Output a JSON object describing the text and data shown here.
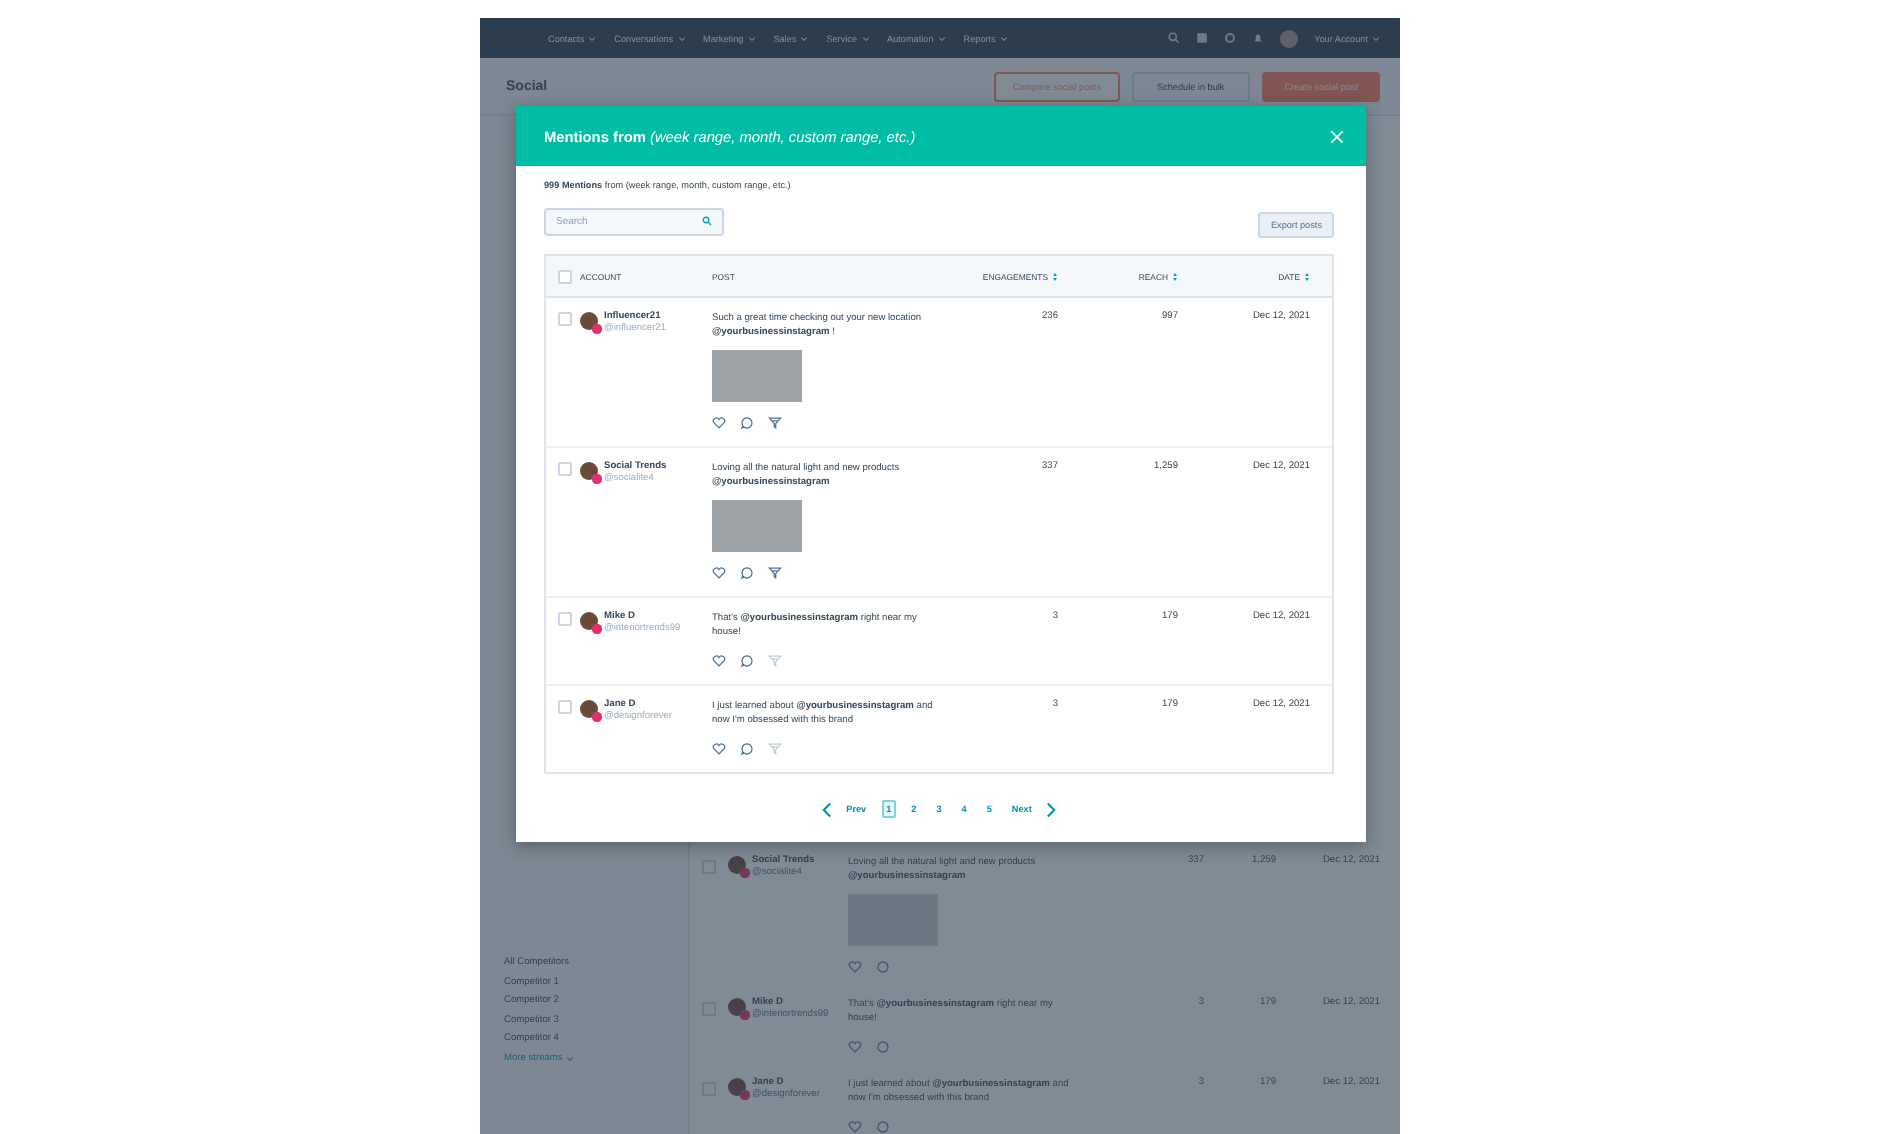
{
  "nav": {
    "items": [
      {
        "label": "Contacts"
      },
      {
        "label": "Conversations"
      },
      {
        "label": "Marketing"
      },
      {
        "label": "Sales"
      },
      {
        "label": "Service"
      },
      {
        "label": "Automation"
      },
      {
        "label": "Reports"
      }
    ],
    "account_label": "Your Account"
  },
  "page": {
    "title": "Social",
    "buttons": [
      {
        "label": "Compare social posts",
        "kind": "secondary"
      },
      {
        "label": "Schedule in bulk",
        "kind": "disabled"
      },
      {
        "label": "Create social post",
        "kind": "primary"
      }
    ]
  },
  "sidebar": {
    "items": [
      {
        "label": "All Competitors",
        "kind": "link"
      },
      {
        "label": "Competitor 1",
        "kind": "link"
      },
      {
        "label": "Competitor 2",
        "kind": "link"
      },
      {
        "label": "Competitor 3",
        "kind": "link"
      },
      {
        "label": "Competitor 4",
        "kind": "link"
      },
      {
        "label": "More streams",
        "kind": "more"
      }
    ]
  },
  "background_posts": [
    {
      "checked": false,
      "name": "Social Trends",
      "handle": "@socialite4",
      "post": "Loving all the natural light and new products **@yourbusinessinstagram**",
      "has_photo": true,
      "engagements": "337",
      "reach": "1,259",
      "date": "Dec 12, 2021"
    },
    {
      "checked": false,
      "name": "Mike D",
      "handle": "@interiortrends99",
      "post": "That's **@yourbusinessinstagram** right near my house!",
      "has_photo": false,
      "engagements": "3",
      "reach": "179",
      "date": "Dec 12, 2021"
    },
    {
      "checked": false,
      "name": "Jane D",
      "handle": "@designforever",
      "post": "I just learned about **@yourbusinessinstagram** and now I'm obsessed with this brand",
      "has_photo": false,
      "engagements": "3",
      "reach": "179",
      "date": "Dec 12, 2021"
    }
  ],
  "modal": {
    "title": "**Mentions from** *(week range, month, custom range, etc.)*",
    "summary": "**999 Mentions** from (week range, month, custom range, etc.)",
    "search": {
      "placeholder": "Search"
    },
    "export_button": "Export posts",
    "select_all_checked": false,
    "columns": [
      {
        "label": "ACCOUNT",
        "sortable": false
      },
      {
        "label": "POST",
        "sortable": false
      },
      {
        "label": "ENGAGEMENTS",
        "sortable": true
      },
      {
        "label": "REACH",
        "sortable": true
      },
      {
        "label": "DATE",
        "sortable": true
      }
    ],
    "rows": [
      {
        "checked": false,
        "name": "Influencer21",
        "handle": "@influencer21",
        "post": "Such a great time checking out your new location **@yourbusinessinstagram** !",
        "has_photo": true,
        "actions": [
          {
            "kind": "like",
            "disabled": false
          },
          {
            "kind": "comment",
            "disabled": false
          },
          {
            "kind": "boost",
            "disabled": false
          }
        ],
        "engagements": "236",
        "reach": "997",
        "date": "Dec 12, 2021"
      },
      {
        "checked": false,
        "name": "Social Trends",
        "handle": "@socialite4",
        "post": "Loving all the natural light and new products **@yourbusinessinstagram**",
        "has_photo": true,
        "actions": [
          {
            "kind": "like",
            "disabled": false
          },
          {
            "kind": "comment",
            "disabled": false
          },
          {
            "kind": "boost",
            "disabled": false
          }
        ],
        "engagements": "337",
        "reach": "1,259",
        "date": "Dec 12, 2021"
      },
      {
        "checked": false,
        "name": "Mike D",
        "handle": "@interiortrends99",
        "post": "That's **@yourbusinessinstagram** right near my house!",
        "has_photo": false,
        "actions": [
          {
            "kind": "like",
            "disabled": false
          },
          {
            "kind": "comment",
            "disabled": false
          },
          {
            "kind": "boost",
            "disabled": true
          }
        ],
        "engagements": "3",
        "reach": "179",
        "date": "Dec 12, 2021"
      },
      {
        "checked": false,
        "name": "Jane D",
        "handle": "@designforever",
        "post": "I just learned about **@yourbusinessinstagram** and now I'm obsessed with this brand",
        "has_photo": false,
        "actions": [
          {
            "kind": "like",
            "disabled": false
          },
          {
            "kind": "comment",
            "disabled": false
          },
          {
            "kind": "boost",
            "disabled": true
          }
        ],
        "engagements": "3",
        "reach": "179",
        "date": "Dec 12, 2021"
      }
    ],
    "pagination": {
      "prev": "Prev",
      "next": "Next",
      "pages": [
        {
          "label": "1",
          "selected": true
        },
        {
          "label": "2",
          "selected": false
        },
        {
          "label": "3",
          "selected": false
        },
        {
          "label": "4",
          "selected": false
        },
        {
          "label": "5",
          "selected": false
        }
      ]
    }
  }
}
